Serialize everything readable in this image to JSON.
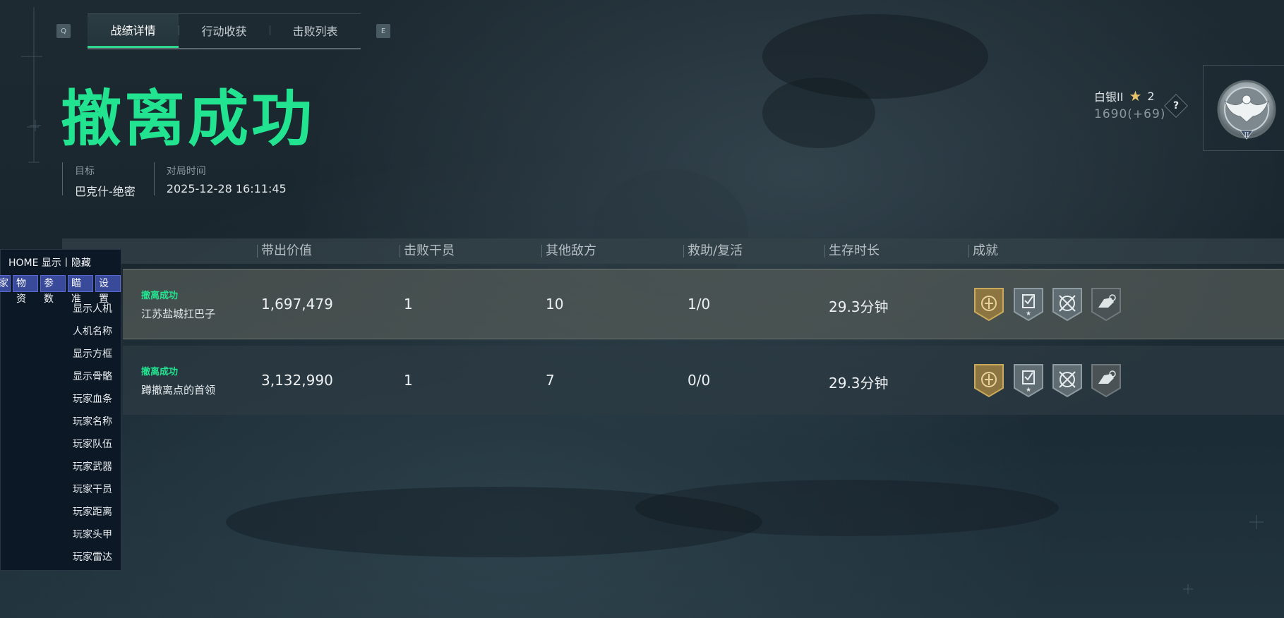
{
  "tabs": {
    "key_left": "Q",
    "key_right": "E",
    "items": [
      {
        "label": "战绩详情",
        "active": true
      },
      {
        "label": "行动收获",
        "active": false
      },
      {
        "label": "击败列表",
        "active": false
      }
    ]
  },
  "result_title": "撤离成功",
  "meta": {
    "target_label": "目标",
    "target_value": "巴克什-绝密",
    "time_label": "对局时间",
    "time_value": "2025-12-28 16:11:45"
  },
  "rank": {
    "name": "白银II",
    "stars": "2",
    "points": "1690(+69)",
    "help": "?",
    "badge_tier": "II"
  },
  "table": {
    "headers": [
      "带出价值",
      "击败干员",
      "其他敌方",
      "救助/复活",
      "生存时长",
      "成就"
    ],
    "rows": [
      {
        "status": "撤离成功",
        "name": "江苏盐城扛巴子",
        "value": "1,697,479",
        "kills": "1",
        "other": "10",
        "assist": "1/0",
        "time": "29.3分钟"
      },
      {
        "status": "撤离成功",
        "name": "蹲撤离点的首领",
        "value": "3,132,990",
        "kills": "1",
        "other": "7",
        "assist": "0/0",
        "time": "29.3分钟"
      }
    ]
  },
  "overlay_menu": {
    "title": "HOME 显示丨隐藏",
    "tabs": [
      "家",
      "物资",
      "参数",
      "瞄准",
      "设置"
    ],
    "items": [
      "显示人机",
      "人机名称",
      "显示方框",
      "显示骨骼",
      "玩家血条",
      "玩家名称",
      "玩家队伍",
      "玩家武器",
      "玩家干员",
      "玩家距离",
      "玩家头甲",
      "玩家雷达"
    ]
  },
  "colors": {
    "accent_green": "#22e38f",
    "gold_badge": "#b8984a",
    "silver_badge": "#8a979c",
    "menu_tab_blue": "#3a4a9a"
  },
  "icons": {
    "achievements": [
      "gold-emblem-icon",
      "checklist-star-icon",
      "crosshair-cross-icon",
      "hand-target-icon"
    ],
    "rank_badge": "eagle-rank-badge-icon"
  }
}
